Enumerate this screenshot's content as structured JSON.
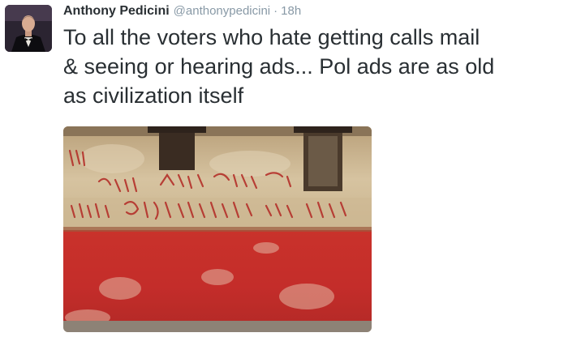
{
  "tweet": {
    "author_name": "Anthony Pedicini",
    "author_handle": "@anthonypedicini",
    "separator": "·",
    "timestamp": "18h",
    "text": "To all the voters who hate getting calls mail\n& seeing or hearing ads... Pol ads are as old\nas civilization itself"
  },
  "colors": {
    "text": "#292f33",
    "meta": "#8899a6",
    "wall_red": "#c62a2a",
    "wall_plaster": "#d8c6a4",
    "paint_red": "#b4302a"
  }
}
